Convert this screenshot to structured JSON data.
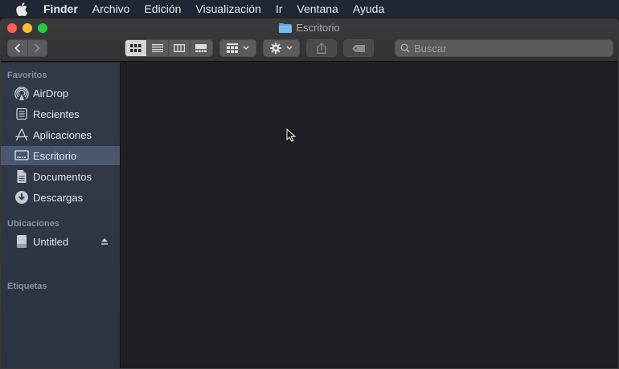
{
  "menubar": {
    "app": "Finder",
    "items": [
      "Archivo",
      "Edición",
      "Visualización",
      "Ir",
      "Ventana",
      "Ayuda"
    ]
  },
  "window": {
    "title": "Escritorio"
  },
  "toolbar": {
    "search_placeholder": "Buscar",
    "active_view": "icons"
  },
  "sidebar": {
    "favorites_header": "Favoritos",
    "favorites": [
      {
        "label": "AirDrop",
        "icon": "airdrop-icon"
      },
      {
        "label": "Recientes",
        "icon": "recents-icon"
      },
      {
        "label": "Aplicaciones",
        "icon": "applications-icon"
      },
      {
        "label": "Escritorio",
        "icon": "desktop-icon",
        "selected": true
      },
      {
        "label": "Documentos",
        "icon": "documents-icon"
      },
      {
        "label": "Descargas",
        "icon": "downloads-icon"
      }
    ],
    "locations_header": "Ubicaciones",
    "locations": [
      {
        "label": "Untitled",
        "icon": "disk-icon"
      }
    ],
    "tags_header": "Etiquetas"
  },
  "colors": {
    "selection": "#4a5770",
    "sidebar_bg": "#323a48",
    "content_bg": "#1e1f24"
  }
}
